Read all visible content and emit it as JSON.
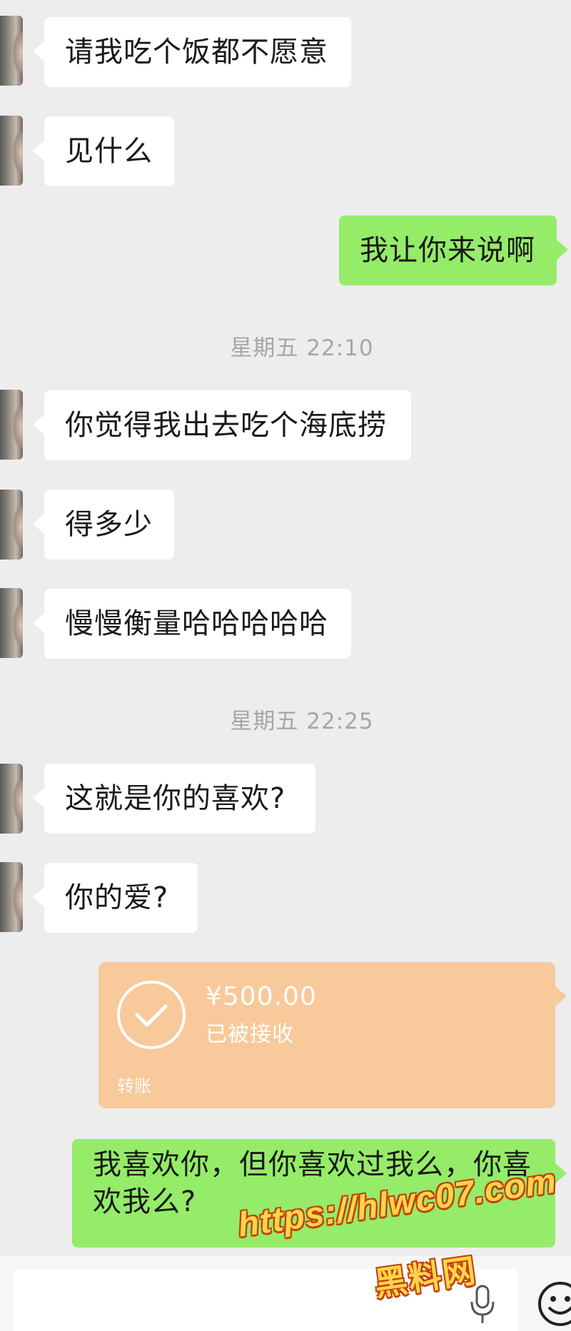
{
  "messages": [
    {
      "side": "in",
      "text": "请我吃个饭都不愿意"
    },
    {
      "side": "in",
      "text": "见什么"
    },
    {
      "side": "out",
      "text": "我让你来说啊"
    },
    {
      "side": "in",
      "text": "你觉得我出去吃个海底捞"
    },
    {
      "side": "in",
      "text": "得多少"
    },
    {
      "side": "in",
      "text": "慢慢衡量哈哈哈哈哈"
    },
    {
      "side": "in",
      "text": "这就是你的喜欢?"
    },
    {
      "side": "in",
      "text": "你的爱?"
    },
    {
      "side": "out",
      "text": "我喜欢你，但你喜欢过我么，你喜欢我么?"
    }
  ],
  "timestamps": [
    "星期五 22:10",
    "星期五 22:25"
  ],
  "transfer": {
    "amount": "¥500.00",
    "status": "已被接收",
    "label": "转账"
  },
  "input_bar": {
    "value": "",
    "icons": [
      "mic-icon",
      "emoji-icon"
    ]
  },
  "watermark": {
    "url": "https://hlwc07.com",
    "name": "黑料网"
  },
  "colors": {
    "background": "#ededed",
    "incoming": "#ffffff",
    "outgoing": "#95ec69",
    "transfer": "#f8c99a",
    "timestamp": "#a6a6a6"
  }
}
